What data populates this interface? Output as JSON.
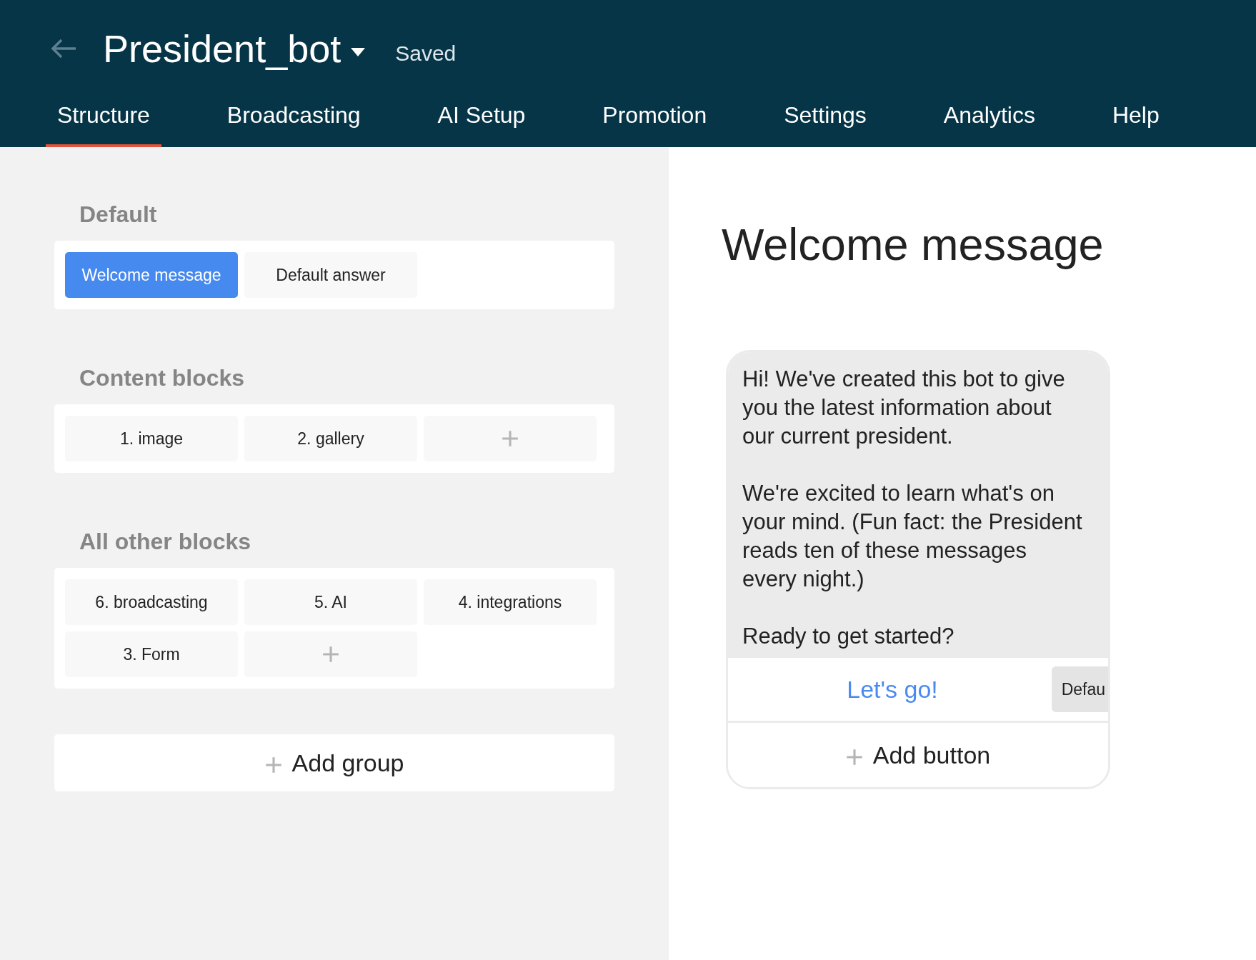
{
  "header": {
    "bot_name": "President_bot",
    "status": "Saved"
  },
  "tabs": [
    {
      "label": "Structure",
      "selected": true
    },
    {
      "label": "Broadcasting",
      "selected": false
    },
    {
      "label": "AI Setup",
      "selected": false
    },
    {
      "label": "Promotion",
      "selected": false
    },
    {
      "label": "Settings",
      "selected": false
    },
    {
      "label": "Analytics",
      "selected": false
    },
    {
      "label": "Help",
      "selected": false
    }
  ],
  "groups": [
    {
      "title": "Default",
      "blocks": [
        {
          "kind": "block",
          "label": "Welcome message",
          "selected": true
        },
        {
          "kind": "block",
          "label": "Default answer",
          "selected": false
        }
      ]
    },
    {
      "title": "Content blocks",
      "blocks": [
        {
          "kind": "block",
          "label": "1. image",
          "selected": false
        },
        {
          "kind": "block",
          "label": "2. gallery",
          "selected": false
        },
        {
          "kind": "add",
          "selected": false
        }
      ]
    },
    {
      "title": "All other blocks",
      "blocks": [
        {
          "kind": "block",
          "label": "6. broadcasting",
          "selected": false
        },
        {
          "kind": "block",
          "label": "5. AI",
          "selected": false
        },
        {
          "kind": "block",
          "label": "4. integrations",
          "selected": false
        },
        {
          "kind": "block",
          "label": "3. Form",
          "selected": false
        },
        {
          "kind": "add",
          "selected": false
        }
      ]
    }
  ],
  "add_group": {
    "label": "Add group"
  },
  "editor": {
    "title": "Welcome message",
    "message": [
      "Hi! We've created this bot to give you the latest information about our current president.",
      "We're excited to learn what's on your mind. (Fun fact: the President reads ten of these messages every night.)",
      "Ready to get started?"
    ],
    "buttons": [
      {
        "label": "Let's go!",
        "target": "Defau"
      }
    ],
    "add_button": {
      "label": "Add button"
    }
  }
}
